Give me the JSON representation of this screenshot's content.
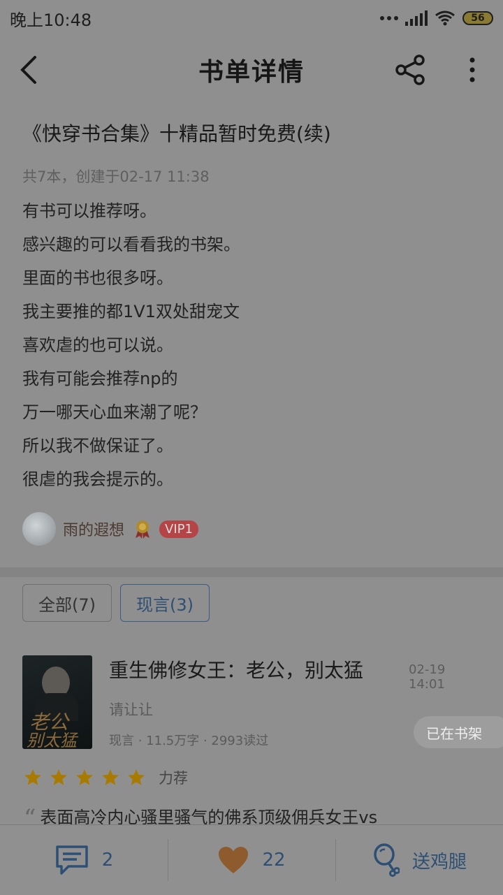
{
  "status_bar": {
    "time": "晚上10:48",
    "battery": "56"
  },
  "header": {
    "title": "书单详情"
  },
  "booklist": {
    "title": "《快穿书合集》十精品暂时免费(续)",
    "meta": "共7本，创建于02-17 11:38",
    "description": [
      "有书可以推荐呀。",
      "感兴趣的可以看看我的书架。",
      "里面的书也很多呀。",
      "我主要推的都1Ⅴ1双处甜宠文",
      "喜欢虐的也可以说。",
      "我有可能会推荐np的",
      "万一哪天心血来潮了呢？",
      "所以我不做保证了。",
      "很虐的我会提示的。"
    ],
    "author": {
      "name": "雨的遐想",
      "vip": "VIP1"
    }
  },
  "filters": [
    {
      "label": "全部(7)",
      "active": false
    },
    {
      "label": "现言(3)",
      "active": true
    }
  ],
  "book": {
    "title": "重生佛修女王：老公，别太猛",
    "date": "02-19 14:01",
    "author": "请让让",
    "meta": "现言 · 11.5万字 · 2993读过",
    "shelf_label": "已在书架",
    "cover_text_1": "老公",
    "cover_text_2": "别太猛",
    "rating_stars": 5,
    "rating_label": "力荐",
    "excerpt": "表面高冷内心骚里骚气的佛系顶级佣兵女王vs"
  },
  "bottom_bar": {
    "comments": "2",
    "likes": "22",
    "gift": "送鸡腿"
  },
  "colors": {
    "accent": "#2e4f74",
    "overlay_bg": "#8f8f8f",
    "vip": "#b54446",
    "star": "#a97a00"
  }
}
